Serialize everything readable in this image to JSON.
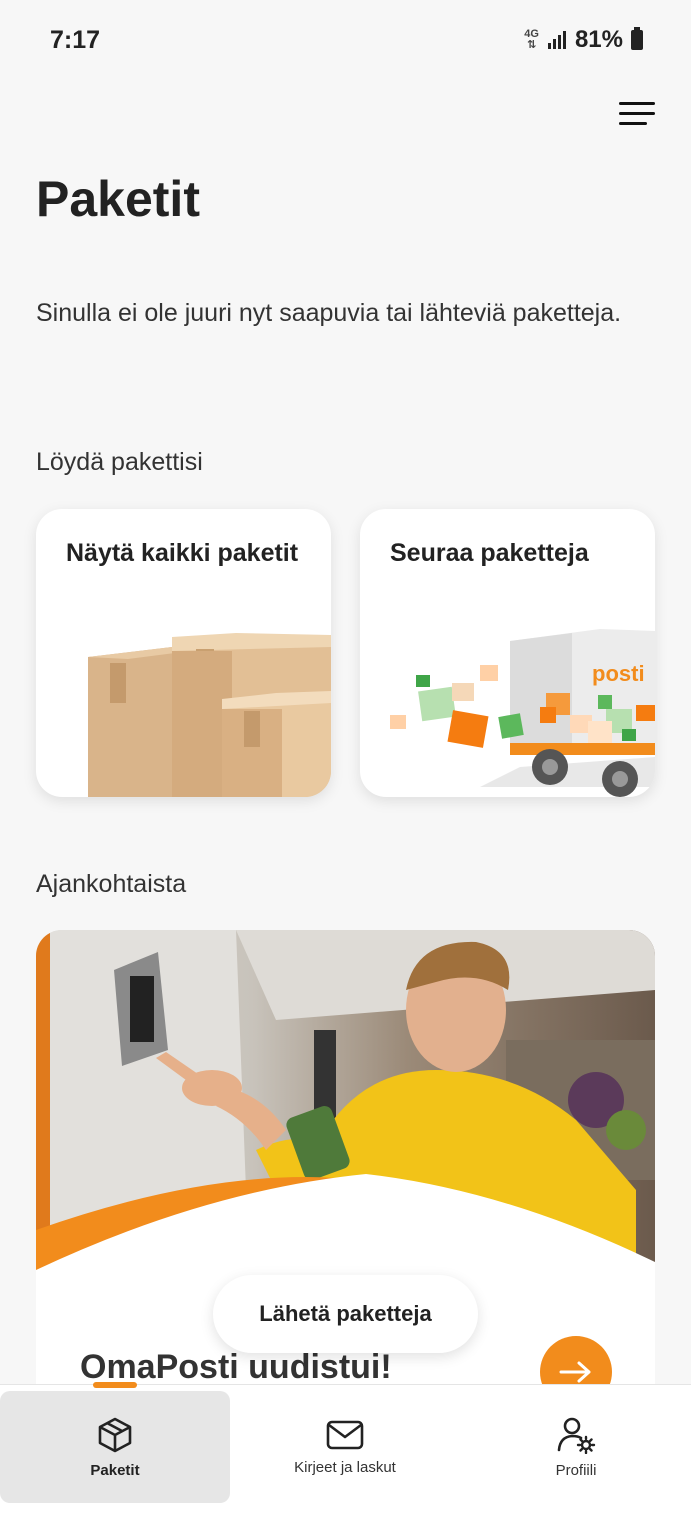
{
  "status_bar": {
    "time": "7:17",
    "network": "4G",
    "battery": "81%"
  },
  "header": {
    "menu_icon": "hamburger-menu-icon"
  },
  "page": {
    "title": "Paketit",
    "intro": "Sinulla ei ole juuri nyt saapuvia tai lähteviä paketteja."
  },
  "find_section": {
    "label": "Löydä pakettisi",
    "cards": [
      {
        "title": "Näytä kaikki paketit",
        "icon": "boxes-illustration"
      },
      {
        "title": "Seuraa paketteja",
        "icon": "delivery-truck-illustration",
        "brand": "posti"
      }
    ]
  },
  "news_section": {
    "label": "Ajankohtaista",
    "headline": "OmaPosti uudistui!"
  },
  "fab": {
    "label": "Lähetä paketteja"
  },
  "bottom_nav": {
    "items": [
      {
        "label": "Paketit",
        "icon": "package-icon",
        "active": true
      },
      {
        "label": "Kirjeet ja laskut",
        "icon": "envelope-icon",
        "active": false
      },
      {
        "label": "Profiili",
        "icon": "profile-settings-icon",
        "active": false
      }
    ]
  },
  "colors": {
    "accent": "#f28c1c",
    "background": "#f7f7f7",
    "green": "#5cb85c"
  }
}
